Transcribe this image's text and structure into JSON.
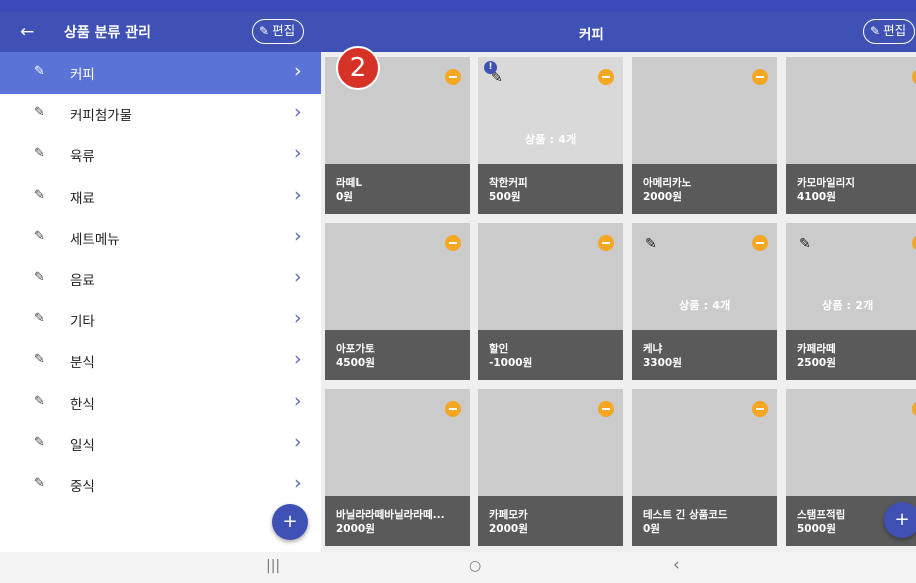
{
  "status_bar": {
    "text": ""
  },
  "header": {
    "back_icon": "arrow-back-icon",
    "title": "상품 분류 관리",
    "edit_label_left": "편집",
    "main_title": "커피",
    "edit_label_right": "편집"
  },
  "categories": [
    {
      "label": "커피",
      "active": true
    },
    {
      "label": "커피첨가물",
      "active": false
    },
    {
      "label": "육류",
      "active": false
    },
    {
      "label": "재료",
      "active": false
    },
    {
      "label": "세트메뉴",
      "active": false
    },
    {
      "label": "음료",
      "active": false
    },
    {
      "label": "기타",
      "active": false
    },
    {
      "label": "분식",
      "active": false
    },
    {
      "label": "한식",
      "active": false
    },
    {
      "label": "일식",
      "active": false
    },
    {
      "label": "중식",
      "active": false
    }
  ],
  "products": [
    {
      "name": "라떼L",
      "price": "0원",
      "pen": false,
      "sub_count": ""
    },
    {
      "name": "착한커피",
      "price": "500원",
      "pen": true,
      "sub_count": "상품 : 4개",
      "alert": "!"
    },
    {
      "name": "아메리카노",
      "price": "2000원",
      "pen": false,
      "sub_count": ""
    },
    {
      "name": "카모마일리지",
      "price": "4100원",
      "pen": false,
      "sub_count": ""
    },
    {
      "name": "아포가토",
      "price": "4500원",
      "pen": false,
      "sub_count": ""
    },
    {
      "name": "할인",
      "price": "-1000원",
      "pen": false,
      "sub_count": ""
    },
    {
      "name": "케냐",
      "price": "3300원",
      "pen": true,
      "sub_count": "상품 : 4개"
    },
    {
      "name": "카페라떼",
      "price": "2500원",
      "pen": true,
      "sub_count": "상품 : 2개"
    },
    {
      "name": "바닐라라떼바닐라라떼...",
      "price": "2000원",
      "pen": false,
      "sub_count": ""
    },
    {
      "name": "카페모카",
      "price": "2000원",
      "pen": false,
      "sub_count": ""
    },
    {
      "name": "테스트 긴 상품코드",
      "price": "0원",
      "pen": false,
      "sub_count": ""
    },
    {
      "name": "스탬프적립",
      "price": "5000원",
      "pen": false,
      "sub_count": ""
    }
  ],
  "step_badge": "2",
  "fab_label": "+",
  "nav": {
    "recents": "|||",
    "home": "○",
    "back": "‹"
  },
  "colors": {
    "primary": "#3f51b5",
    "active_item": "#5a73d6",
    "minus_badge": "#f5a623",
    "card_footer": "#5a5a5a",
    "step_badge": "#d63228"
  }
}
